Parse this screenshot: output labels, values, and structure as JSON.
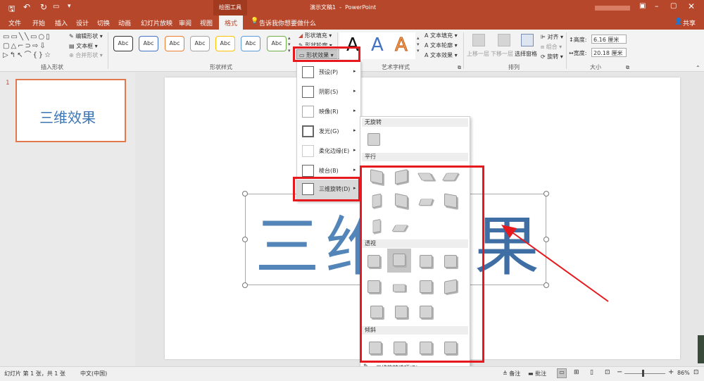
{
  "titlebar": {
    "context_tab": "绘图工具",
    "doc_title": "演示文稿1  -  PowerPoint",
    "share": "共享"
  },
  "tabs": [
    "文件",
    "开始",
    "插入",
    "设计",
    "切换",
    "动画",
    "幻灯片放映",
    "审阅",
    "视图",
    "格式"
  ],
  "tellme": "告诉我你想要做什么",
  "ribbon": {
    "insert_shapes": {
      "edit_shape": "编辑形状",
      "text_box": "文本框",
      "merge_shapes": "合并形状",
      "label": "插入形状"
    },
    "shape_styles": {
      "samples": [
        "Abc",
        "Abc",
        "Abc",
        "Abc",
        "Abc",
        "Abc",
        "Abc"
      ],
      "fill": "形状填充",
      "outline": "形状轮廓",
      "effects": "形状效果",
      "label": "形状样式"
    },
    "wordart": {
      "text_fill": "文本填充",
      "text_outline": "文本轮廓",
      "text_effects": "文本效果",
      "label": "艺术字样式",
      "samples": [
        "A",
        "A",
        "A"
      ]
    },
    "arrange": {
      "bring_forward": "上移一层",
      "send_backward": "下移一层",
      "selection_pane": "选择窗格",
      "align": "对齐",
      "group": "组合",
      "rotate": "旋转",
      "label": "排列"
    },
    "size": {
      "height_label": "高度:",
      "height": "6.16 厘米",
      "width_label": "宽度:",
      "width": "20.18 厘米",
      "label": "大小"
    }
  },
  "thumbnail": {
    "number": "1",
    "text": "三维效果"
  },
  "slide": {
    "text_left": "三",
    "text_mid": "维",
    "text_right": "果"
  },
  "effects_menu": {
    "items": [
      {
        "label": "预设(P)",
        "arrow": "▸"
      },
      {
        "label": "阴影(S)",
        "arrow": "▸"
      },
      {
        "label": "映像(R)",
        "arrow": "▸"
      },
      {
        "label": "发光(G)",
        "arrow": "▸"
      },
      {
        "label": "柔化边缘(E)",
        "arrow": "▸"
      },
      {
        "label": "棱台(B)",
        "arrow": "▸"
      },
      {
        "label": "三维旋转(D)",
        "arrow": "▸"
      }
    ]
  },
  "rotation_menu": {
    "no_rotation": "无旋转",
    "parallel": "平行",
    "perspective": "透视",
    "oblique": "倾斜",
    "options": "三维旋转选项(R)..."
  },
  "status": {
    "slide_info": "幻灯片 第 1 张，共 1 张",
    "language": "中文(中国)",
    "notes": "备注",
    "comments": "批注",
    "zoom": "86%",
    "zoom_minus": "−",
    "zoom_plus": "+"
  }
}
